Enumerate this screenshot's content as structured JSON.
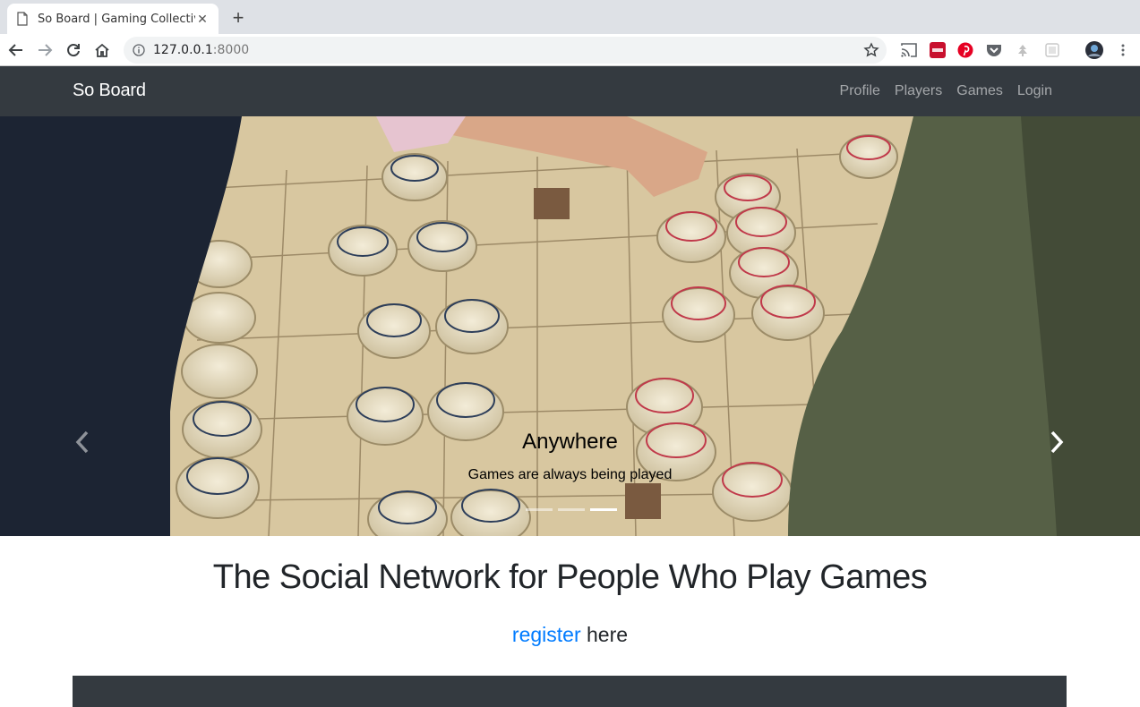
{
  "browser": {
    "tab_title": "So Board | Gaming Collective",
    "url_host": "127.0.0.1",
    "url_port": ":8000"
  },
  "navbar": {
    "brand": "So Board",
    "links": [
      "Profile",
      "Players",
      "Games",
      "Login"
    ]
  },
  "carousel": {
    "caption_title": "Anywhere",
    "caption_text": "Games are always being played",
    "slide_count": 3,
    "active_slide": 3
  },
  "main": {
    "headline": "The Social Network for People Who Play Games",
    "register_link": "register",
    "register_suffix": " here"
  },
  "colors": {
    "navbar_bg": "#343a40",
    "link_blue": "#007bff",
    "text_dark": "#212529"
  }
}
